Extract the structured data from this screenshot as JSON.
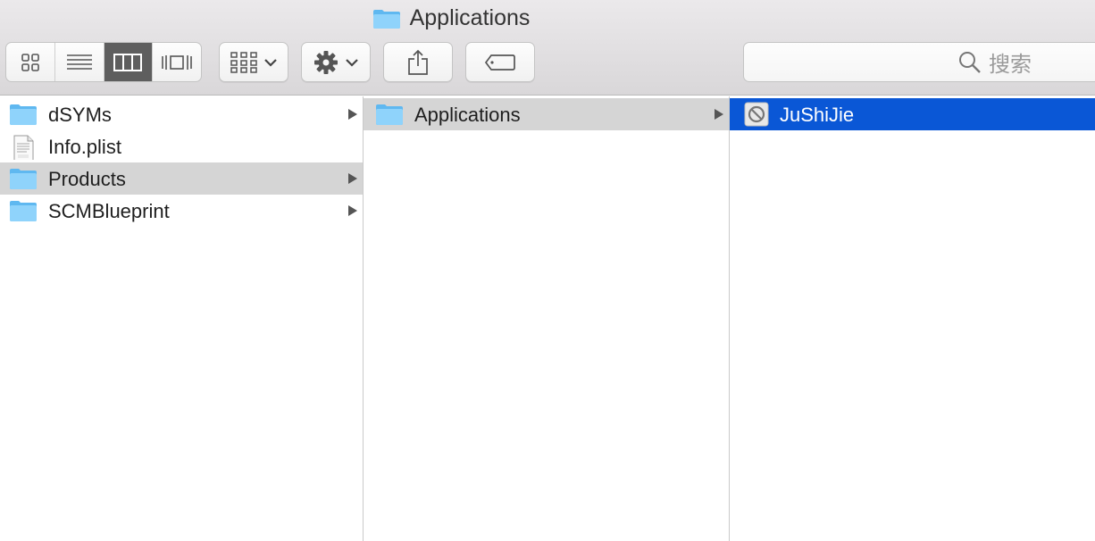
{
  "window": {
    "title": "Applications",
    "title_icon": "folder-icon"
  },
  "toolbar": {
    "view_buttons": [
      {
        "name": "icon-view",
        "icon": "grid-icon",
        "active": false
      },
      {
        "name": "list-view",
        "icon": "list-icon",
        "active": false
      },
      {
        "name": "column-view",
        "icon": "columns-icon",
        "active": true
      },
      {
        "name": "cover-flow-view",
        "icon": "coverflow-icon",
        "active": false
      }
    ],
    "arrange_icon": "arrange-icon",
    "action_icon": "gear-icon",
    "share_icon": "share-icon",
    "tag_icon": "tag-icon"
  },
  "search": {
    "icon": "search-icon",
    "placeholder": "搜索"
  },
  "columns": [
    {
      "items": [
        {
          "label": "dSYMs",
          "icon": "folder-icon",
          "has_children": true,
          "selected": false
        },
        {
          "label": "Info.plist",
          "icon": "plist-file-icon",
          "has_children": false,
          "selected": false
        },
        {
          "label": "Products",
          "icon": "folder-icon",
          "has_children": true,
          "selected": true
        },
        {
          "label": "SCMBlueprint",
          "icon": "folder-icon",
          "has_children": true,
          "selected": false
        }
      ]
    },
    {
      "items": [
        {
          "label": "Applications",
          "icon": "folder-icon",
          "has_children": true,
          "selected": true
        }
      ]
    },
    {
      "items": [
        {
          "label": "JuShiJie",
          "icon": "app-icon",
          "has_children": false,
          "selected": true,
          "focused": true
        }
      ]
    }
  ],
  "colors": {
    "selection_active": "#0a57d6",
    "selection_inactive": "#d5d5d5",
    "folder": "#6cc3f5"
  }
}
